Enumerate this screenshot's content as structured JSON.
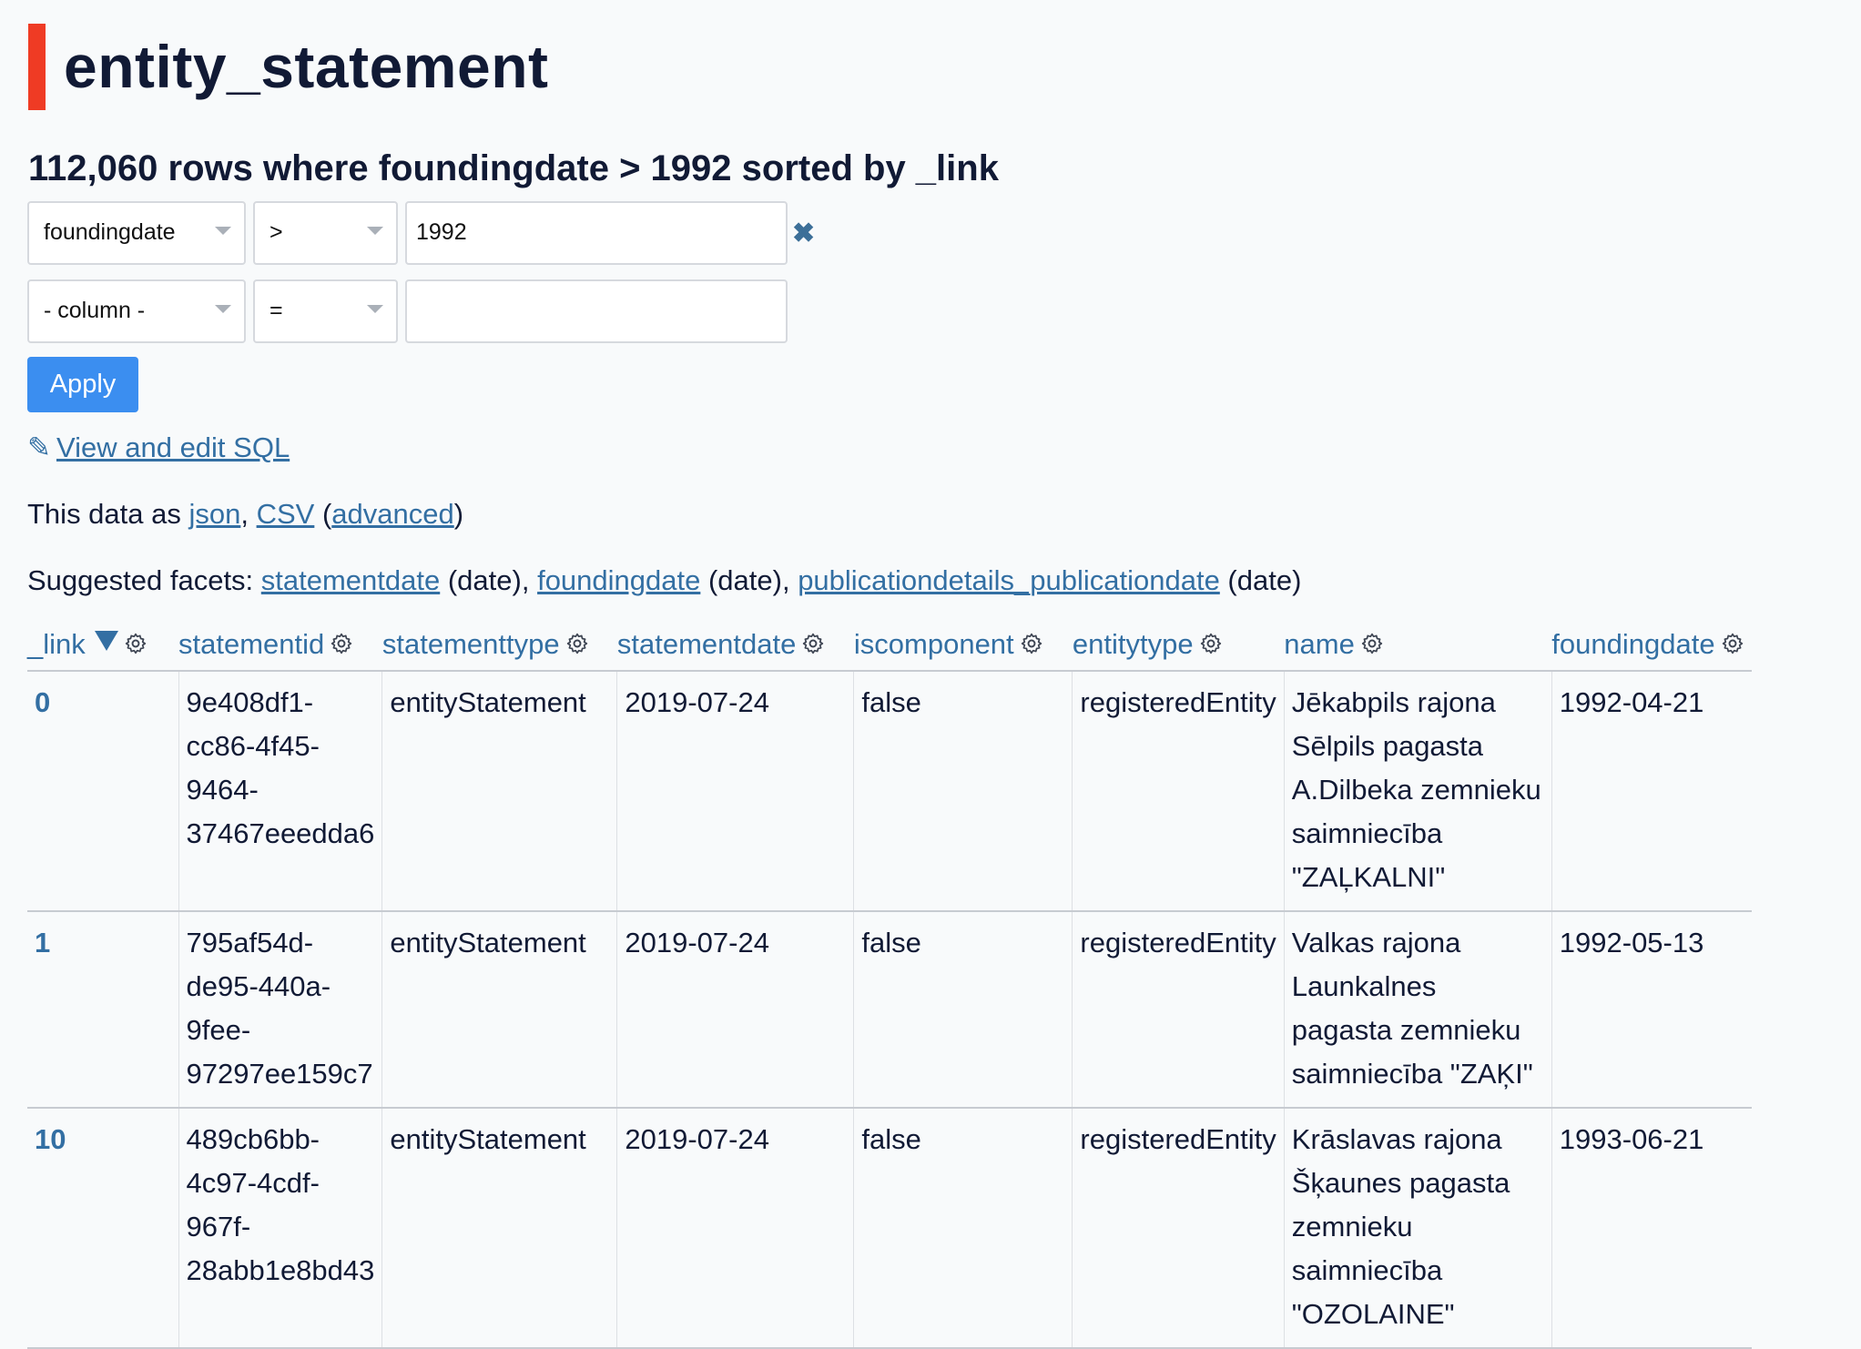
{
  "page": {
    "title": "entity_statement",
    "summary": "112,060 rows where foundingdate > 1992 sorted by _link"
  },
  "filters": [
    {
      "column": "foundingdate",
      "op": ">",
      "value": "1992"
    },
    {
      "column": "- column -",
      "op": "=",
      "value": ""
    }
  ],
  "apply_label": "Apply",
  "sql": {
    "icon": "✎",
    "label": "View and edit SQL"
  },
  "export": {
    "prefix": "This data as ",
    "json": "json",
    "sep": ", ",
    "csv": "CSV",
    "open": " (",
    "advanced": "advanced",
    "close": ")"
  },
  "facets": {
    "prefix": "Suggested facets: ",
    "items": [
      {
        "name": "statementdate",
        "type": " (date), "
      },
      {
        "name": "foundingdate",
        "type": " (date), "
      },
      {
        "name": "publicationdetails_publicationdate",
        "type": " (date)"
      }
    ]
  },
  "columns": [
    "_link",
    "statementid",
    "statementtype",
    "statementdate",
    "iscomponent",
    "entitytype",
    "name",
    "foundingdate"
  ],
  "rows": [
    {
      "link": "0",
      "statementid": "9e408df1-cc86-4f45-9464-37467eeedda6",
      "statementtype": "entityStatement",
      "statementdate": "2019-07-24",
      "iscomponent": "false",
      "entitytype": "registeredEntity",
      "name": "Jēkabpils rajona Sēlpils pagasta A.Dilbeka zemnieku saimniecība \"ZAĻKALNI\"",
      "foundingdate": "1992-04-21"
    },
    {
      "link": "1",
      "statementid": "795af54d-de95-440a-9fee-97297ee159c7",
      "statementtype": "entityStatement",
      "statementdate": "2019-07-24",
      "iscomponent": "false",
      "entitytype": "registeredEntity",
      "name": "Valkas rajona Launkalnes pagasta zemnieku saimniecība \"ZAĶI\"",
      "foundingdate": "1992-05-13"
    },
    {
      "link": "10",
      "statementid": "489cb6bb-4c97-4cdf-967f-28abb1e8bd43",
      "statementtype": "entityStatement",
      "statementdate": "2019-07-24",
      "iscomponent": "false",
      "entitytype": "registeredEntity",
      "name": "Krāslavas rajona Šķaunes pagasta zemnieku saimniecība \"OZOLAINE\"",
      "foundingdate": "1993-06-21"
    }
  ]
}
